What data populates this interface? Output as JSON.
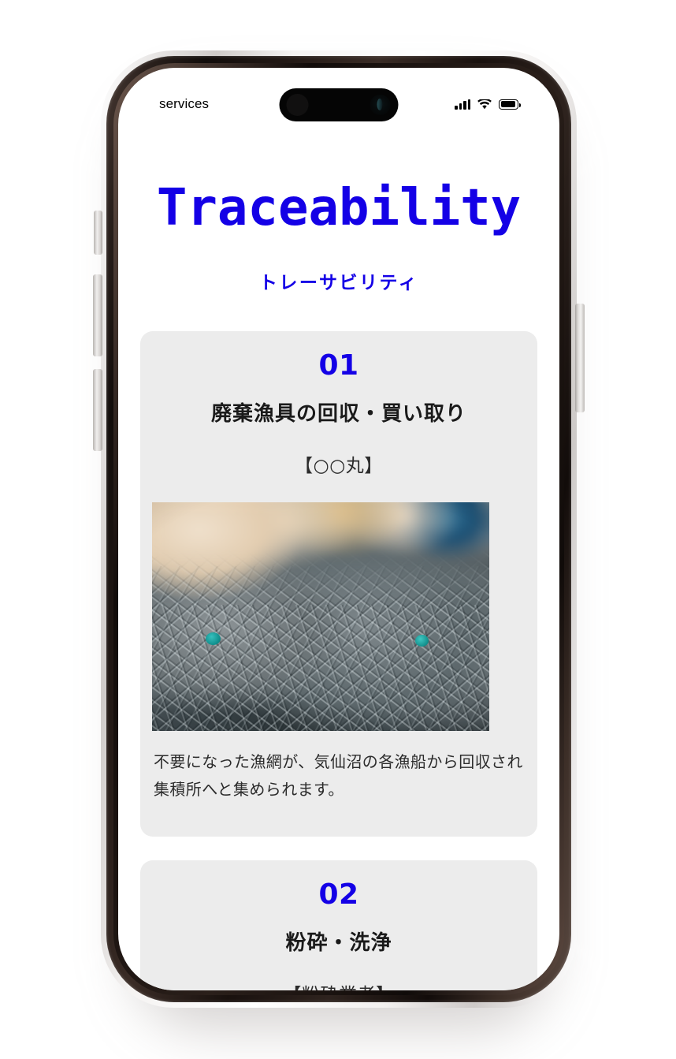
{
  "statusbar": {
    "carrier": "services",
    "signal_icon": "cellular-signal-icon",
    "wifi_icon": "wifi-icon",
    "battery_icon": "battery-full-icon"
  },
  "theme": {
    "accent_blue": "#1400e6",
    "card_bg": "#ececec",
    "screen_bg": "#ffffff",
    "text_dark": "#1a1a1a"
  },
  "header": {
    "title": "Traceability",
    "subtitle": "トレーサビリティ"
  },
  "cards": [
    {
      "number": "01",
      "heading": "廃棄漁具の回収・買い取り",
      "subject": "【○○丸】",
      "photo_alt": "discarded-fishing-net-photo",
      "description": "不要になった漁網が、気仙沼の各漁船から回収され集積所へと集められます。"
    },
    {
      "number": "02",
      "heading": "粉砕・洗浄",
      "subject": "【粉砕業者】"
    }
  ]
}
